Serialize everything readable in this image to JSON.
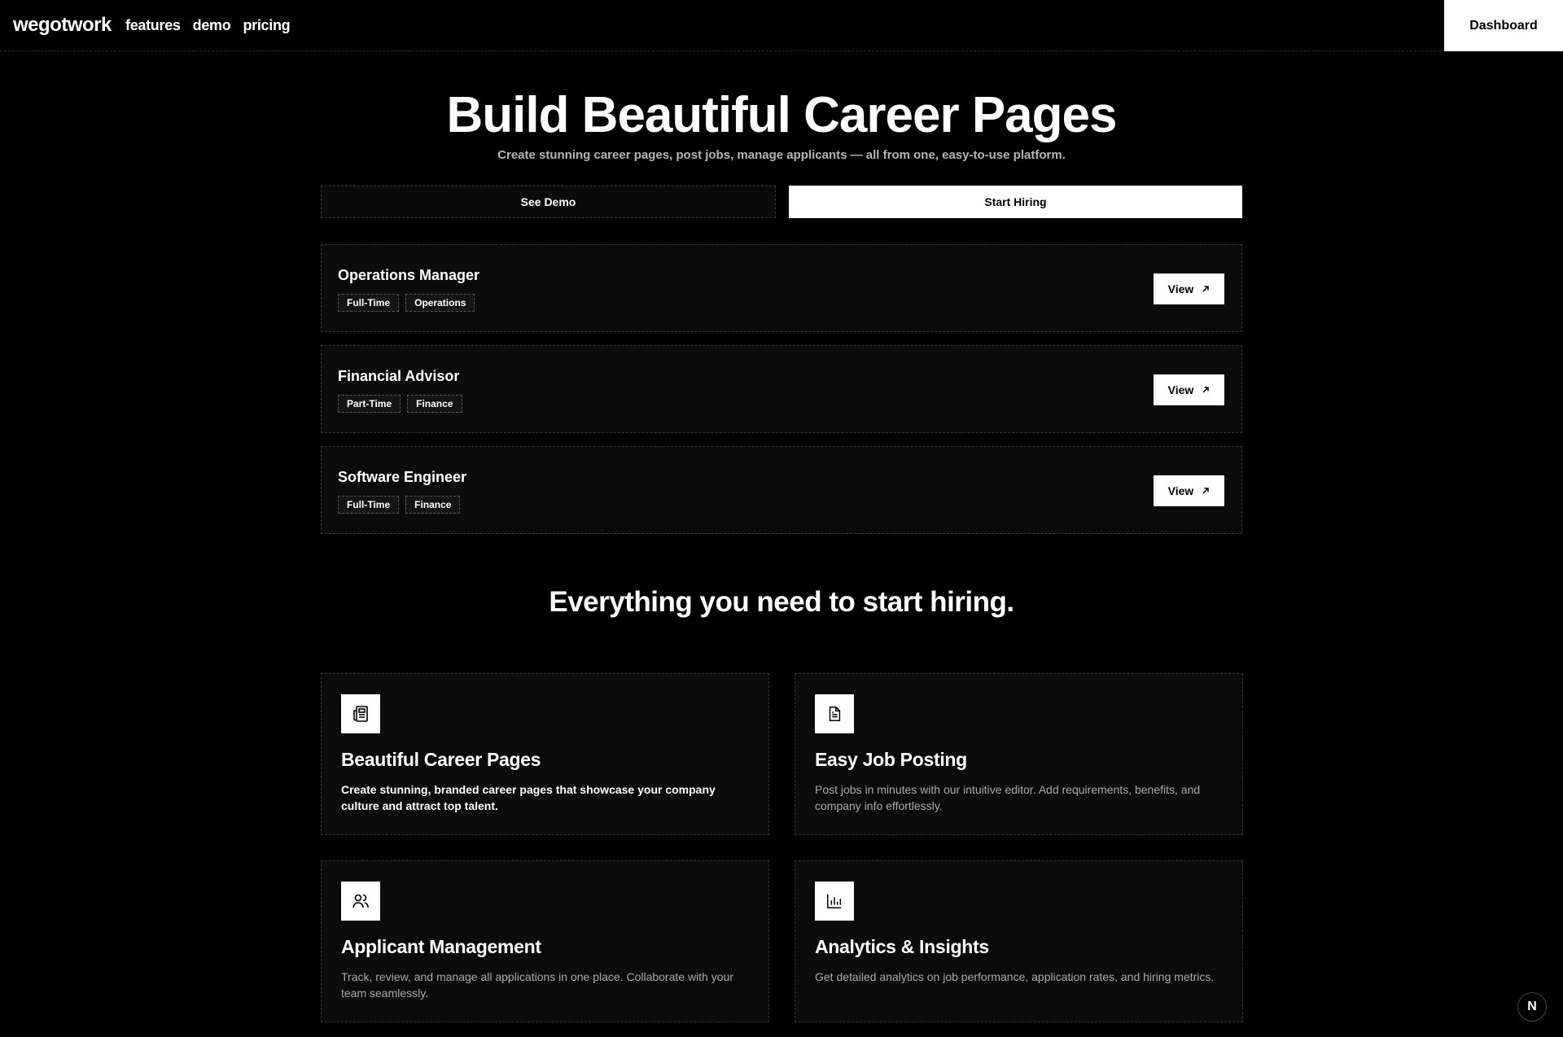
{
  "nav": {
    "brand": "wegotwork",
    "links": [
      "features",
      "demo",
      "pricing"
    ],
    "dashboard_label": "Dashboard"
  },
  "hero": {
    "title": "Build Beautiful Career Pages",
    "subtitle": "Create stunning career pages, post jobs, manage applicants — all from one, easy-to-use platform.",
    "demo_label": "See Demo",
    "hire_label": "Start Hiring"
  },
  "jobs": [
    {
      "title": "Operations Manager",
      "tags": [
        "Full-Time",
        "Operations"
      ],
      "action": "View"
    },
    {
      "title": "Financial Advisor",
      "tags": [
        "Part-Time",
        "Finance"
      ],
      "action": "View"
    },
    {
      "title": "Software Engineer",
      "tags": [
        "Full-Time",
        "Finance"
      ],
      "action": "View"
    }
  ],
  "features_section": {
    "title": "Everything you need to start hiring.",
    "items": [
      {
        "icon": "newspaper-icon",
        "title": "Beautiful Career Pages",
        "desc": "Create stunning, branded career pages that showcase your company culture and attract top talent."
      },
      {
        "icon": "document-icon",
        "title": "Easy Job Posting",
        "desc": "Post jobs in minutes with our intuitive editor. Add requirements, benefits, and company info effortlessly."
      },
      {
        "icon": "users-icon",
        "title": "Applicant Management",
        "desc": "Track, review, and manage all applications in one place. Collaborate with your team seamlessly."
      },
      {
        "icon": "bar-chart-icon",
        "title": "Analytics & Insights",
        "desc": "Get detailed analytics on job performance, application rates, and hiring metrics."
      }
    ]
  },
  "badge": {
    "letter": "N"
  }
}
